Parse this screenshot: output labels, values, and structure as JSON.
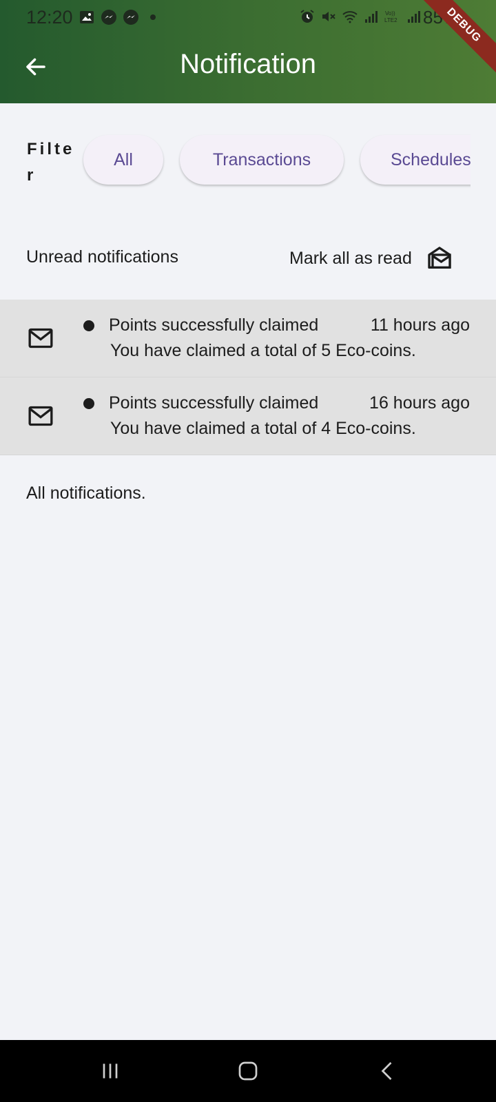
{
  "status_bar": {
    "time": "12:20",
    "battery": "85%",
    "left_icons": [
      "gallery-icon",
      "messenger-icon",
      "messenger-icon",
      "dot-icon"
    ],
    "right_icons": [
      "alarm-icon",
      "mute-icon",
      "wifi-icon",
      "signal-icon",
      "volte-icon",
      "signal-icon"
    ]
  },
  "header": {
    "title": "Notification",
    "debug_label": "DEBUG",
    "bg_colors": [
      "#245a2e",
      "#4e7c35"
    ]
  },
  "filter": {
    "label": "Filter",
    "chips": [
      {
        "label": "All"
      },
      {
        "label": "Transactions"
      },
      {
        "label": "Schedules"
      }
    ]
  },
  "unread": {
    "title": "Unread notifications",
    "mark_all_label": "Mark all as read",
    "items": [
      {
        "title": "Points successfully claimed",
        "time": "11 hours ago",
        "body": "You have claimed a total of 5 Eco-coins."
      },
      {
        "title": "Points successfully claimed",
        "time": "16 hours ago",
        "body": "You have claimed a total of 4 Eco-coins."
      }
    ]
  },
  "all_notifications": {
    "title": "All notifications."
  },
  "nav": {
    "buttons": [
      "recent-apps-icon",
      "home-icon",
      "back-icon"
    ]
  }
}
